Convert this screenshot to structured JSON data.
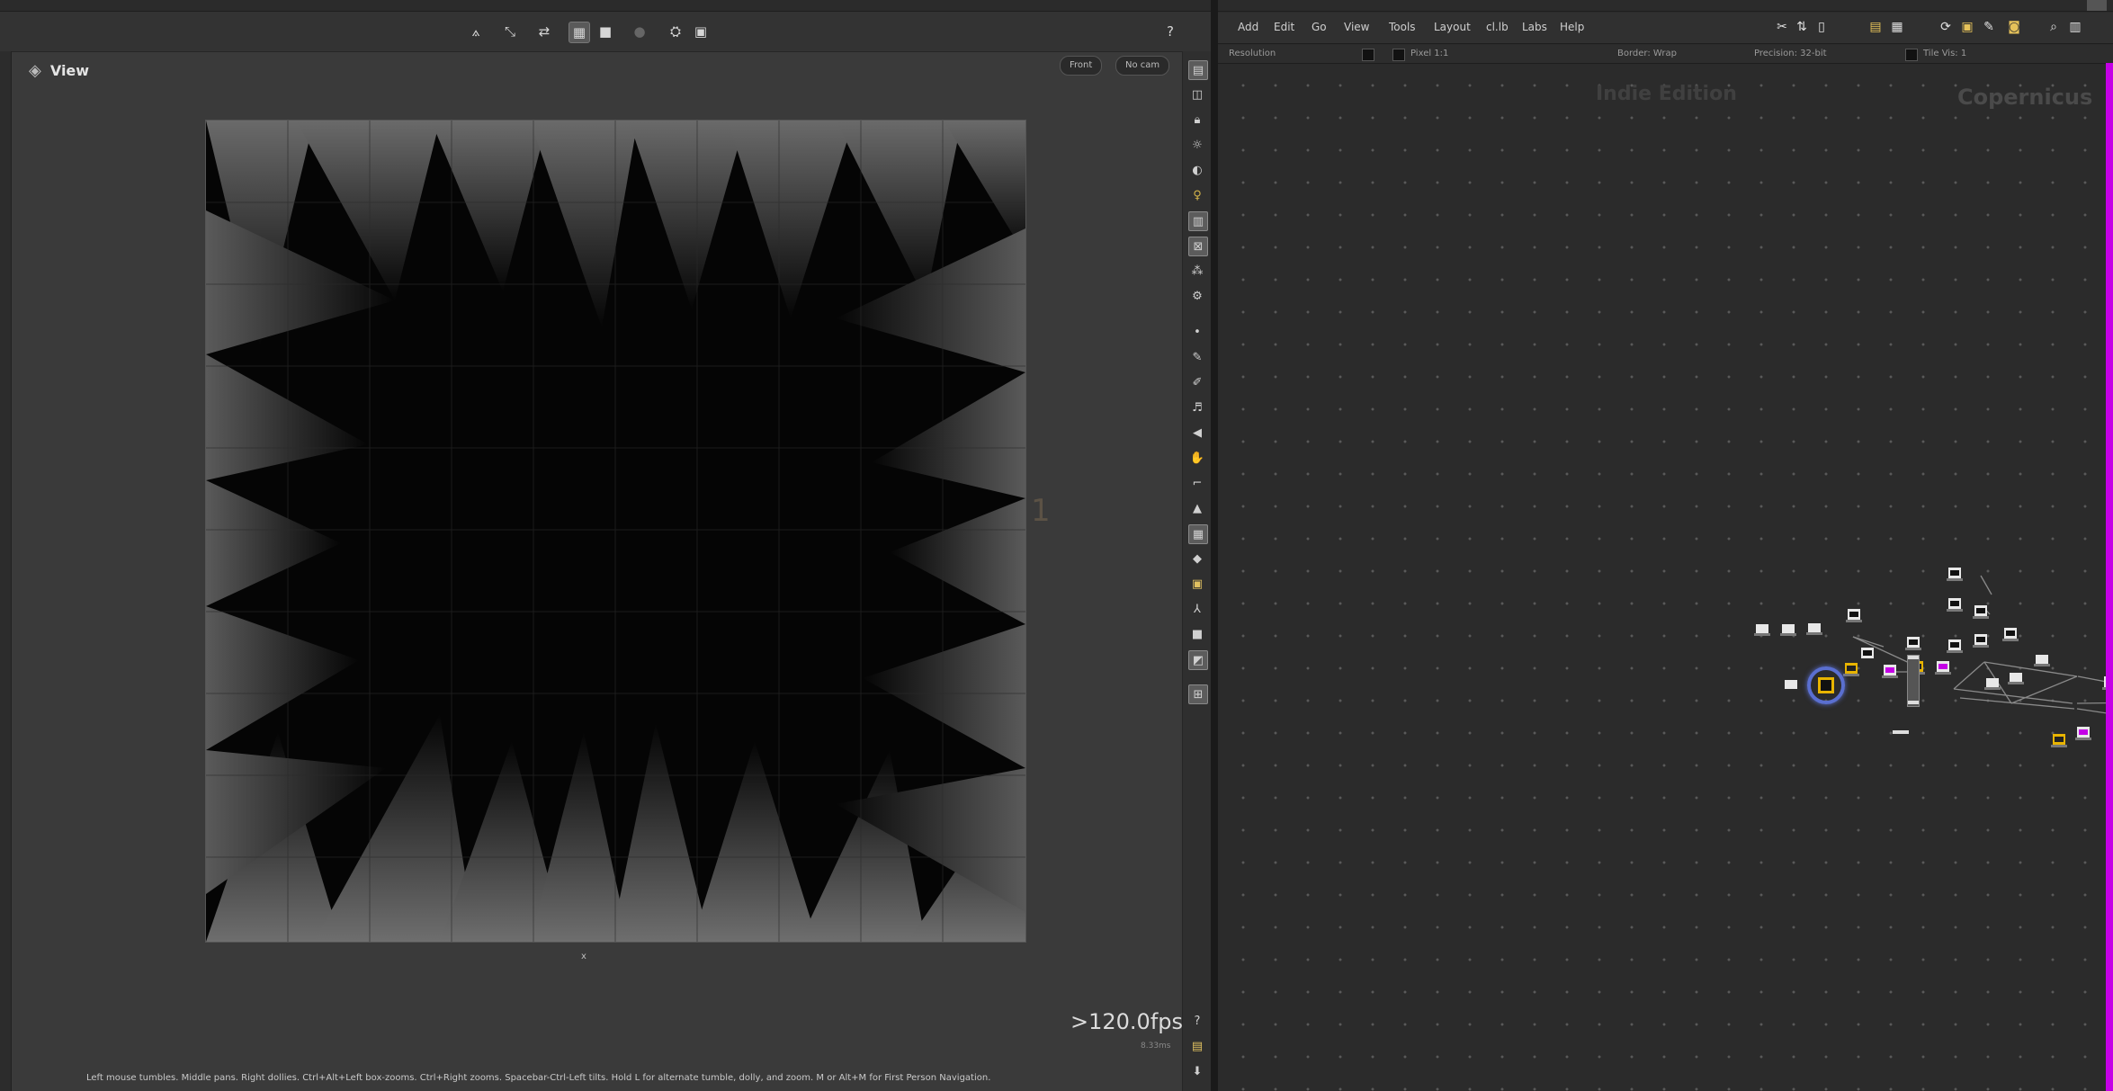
{
  "viewer": {
    "title": "View",
    "camera_pill": "Front",
    "cam_pill": "No cam",
    "frame_number": "1",
    "fps": ">120.0fps",
    "fps_sub": "8.33ms",
    "axis_label": "x",
    "status": "Left mouse tumbles. Middle pans. Right dollies. Ctrl+Alt+Left box-zooms. Ctrl+Right zooms. Spacebar-Ctrl-Left tilts. Hold L for alternate tumble, dolly, and zoom. M or Alt+M for First Person Navigation."
  },
  "viewer_toolbar_icons": [
    "pose-icon",
    "handle-icon",
    "snap-icon",
    "grid-icon",
    "light-icon",
    "sphere-icon",
    "camera-icon",
    "display-icon"
  ],
  "viewer_side_icons": [
    "display-options-icon",
    "render-icon",
    "lock-icon",
    "light-bulb-icon",
    "shade-icon",
    "bulb-icon",
    "box-icon",
    "axis-icon",
    "wand-icon",
    "gear-icon",
    "dot-icon",
    "pen-icon",
    "brush-icon",
    "curve-icon",
    "paint-icon",
    "sculpt-icon",
    "frame-icon",
    "mound-icon",
    "grid-toggle-icon",
    "node-icon",
    "handle-icon",
    "split-icon",
    "square-icon",
    "ref-icon",
    "view-icon"
  ],
  "network": {
    "menu": [
      "Add",
      "Edit",
      "Go",
      "View",
      "Tools",
      "Layout",
      "cl.lb",
      "Labs",
      "Help"
    ],
    "params": {
      "resolution_label": "Resolution",
      "pixel_aspect": "Pixel 1:1",
      "border": "Border: Wrap",
      "precision": "Precision: 32-bit",
      "tile": "Tile Vis: 1"
    },
    "watermark_edition": "Indie Edition",
    "watermark_context": "Copernicus"
  },
  "colors": {
    "accent_selected": "#5a6fd0",
    "scrollbar": "#c400e6",
    "node_yellow": "#e8b400"
  }
}
